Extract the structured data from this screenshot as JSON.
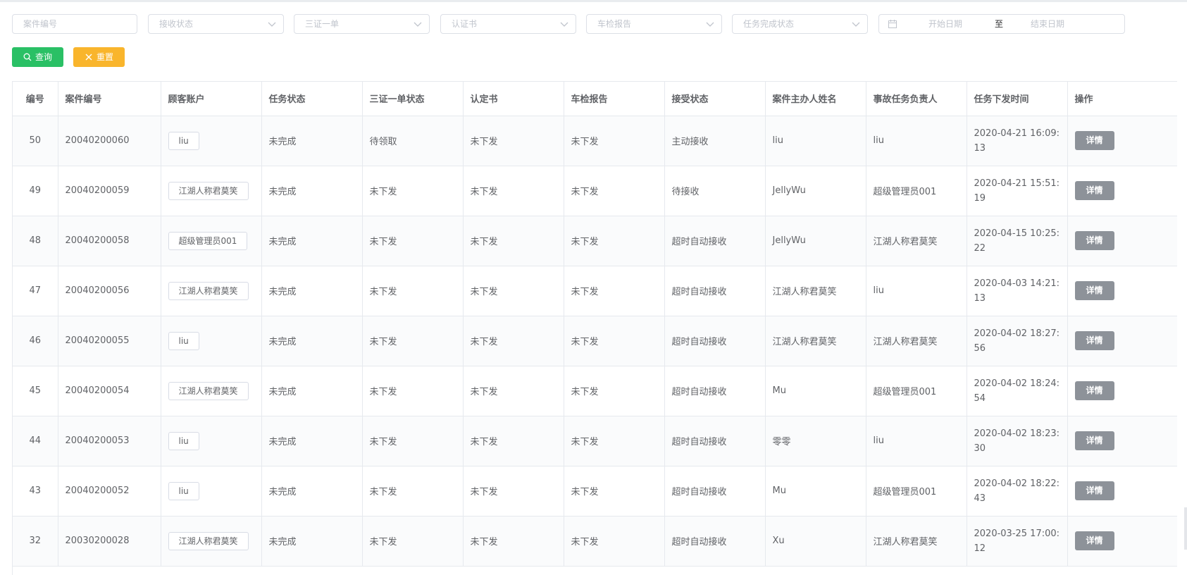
{
  "filters": {
    "case_no": "案件编号",
    "receive_status": "接收状态",
    "three_docs": "三证一单",
    "certificate": "认证书",
    "inspection": "车检报告",
    "task_status": "任务完成状态",
    "date_start": "开始日期",
    "date_sep": "至",
    "date_end": "结束日期"
  },
  "buttons": {
    "query": "查询",
    "reset": "重置"
  },
  "table": {
    "headers": [
      "编号",
      "案件编号",
      "顾客账户",
      "任务状态",
      "三证一单状态",
      "认定书",
      "车检报告",
      "接受状态",
      "案件主办人姓名",
      "事故任务负责人",
      "任务下发时间",
      "操作"
    ],
    "action_label": "详情",
    "rows": [
      {
        "id": "50",
        "case_no": "20040200060",
        "account": "liu",
        "task_status": "未完成",
        "three_docs_status": "待领取",
        "certificate": "未下发",
        "inspection": "未下发",
        "accept_status": "主动接收",
        "host_name": "liu",
        "owner": "liu",
        "time": "2020-04-21 16:09:13"
      },
      {
        "id": "49",
        "case_no": "20040200059",
        "account": "江湖人称君莫笑",
        "task_status": "未完成",
        "three_docs_status": "未下发",
        "certificate": "未下发",
        "inspection": "未下发",
        "accept_status": "待接收",
        "host_name": "JellyWu",
        "owner": "超级管理员001",
        "time": "2020-04-21 15:51:19"
      },
      {
        "id": "48",
        "case_no": "20040200058",
        "account": "超级管理员001",
        "task_status": "未完成",
        "three_docs_status": "未下发",
        "certificate": "未下发",
        "inspection": "未下发",
        "accept_status": "超时自动接收",
        "host_name": "JellyWu",
        "owner": "江湖人称君莫笑",
        "time": "2020-04-15 10:25:22"
      },
      {
        "id": "47",
        "case_no": "20040200056",
        "account": "江湖人称君莫笑",
        "task_status": "未完成",
        "three_docs_status": "未下发",
        "certificate": "未下发",
        "inspection": "未下发",
        "accept_status": "超时自动接收",
        "host_name": "江湖人称君莫笑",
        "owner": "liu",
        "time": "2020-04-03 14:21:13"
      },
      {
        "id": "46",
        "case_no": "20040200055",
        "account": "liu",
        "task_status": "未完成",
        "three_docs_status": "未下发",
        "certificate": "未下发",
        "inspection": "未下发",
        "accept_status": "超时自动接收",
        "host_name": "江湖人称君莫笑",
        "owner": "江湖人称君莫笑",
        "time": "2020-04-02 18:27:56"
      },
      {
        "id": "45",
        "case_no": "20040200054",
        "account": "江湖人称君莫笑",
        "task_status": "未完成",
        "three_docs_status": "未下发",
        "certificate": "未下发",
        "inspection": "未下发",
        "accept_status": "超时自动接收",
        "host_name": "Mu",
        "owner": "超级管理员001",
        "time": "2020-04-02 18:24:54"
      },
      {
        "id": "44",
        "case_no": "20040200053",
        "account": "liu",
        "task_status": "未完成",
        "three_docs_status": "未下发",
        "certificate": "未下发",
        "inspection": "未下发",
        "accept_status": "超时自动接收",
        "host_name": "零零",
        "owner": "liu",
        "time": "2020-04-02 18:23:30"
      },
      {
        "id": "43",
        "case_no": "20040200052",
        "account": "liu",
        "task_status": "未完成",
        "three_docs_status": "未下发",
        "certificate": "未下发",
        "inspection": "未下发",
        "accept_status": "超时自动接收",
        "host_name": "Mu",
        "owner": "超级管理员001",
        "time": "2020-04-02 18:22:43"
      },
      {
        "id": "32",
        "case_no": "20030200028",
        "account": "江湖人称君莫笑",
        "task_status": "未完成",
        "three_docs_status": "未下发",
        "certificate": "未下发",
        "inspection": "未下发",
        "accept_status": "超时自动接收",
        "host_name": "Xu",
        "owner": "江湖人称君莫笑",
        "time": "2020-03-25 17:00:12"
      }
    ]
  },
  "colors": {
    "query_button": "#2ac065",
    "reset_button": "#f9b52c",
    "detail_button": "#8d9299"
  }
}
